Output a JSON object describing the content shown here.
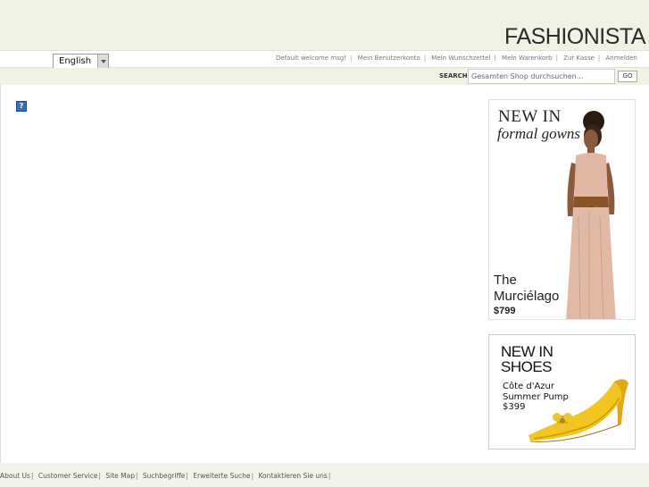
{
  "header": {
    "logo": "FASHIONISTA"
  },
  "topbar": {
    "language": "English",
    "links": [
      "Default welcome msg!",
      "Mein Benutzerkonto",
      "Mein Wunschzettel",
      "Mein Warenkorb",
      "Zur Kasse",
      "Anmelden"
    ]
  },
  "search": {
    "label": "SEARCH",
    "placeholder": "Gesamten Shop durchsuchen...",
    "button": "GO"
  },
  "main": {
    "placeholder_icon": "?"
  },
  "banner_gowns": {
    "title": "NEW IN",
    "subtitle": "formal gowns",
    "name_line1": "The",
    "name_line2": "Murciélago",
    "price": "$799"
  },
  "banner_shoes": {
    "title_line1": "NEW IN",
    "title_line2": "SHOES",
    "product_line1": "Côte d'Azur",
    "product_line2": "Summer Pump",
    "price": "$399"
  },
  "footer": {
    "links": [
      "About Us",
      "Customer Service",
      "Site Map",
      "Suchbegriffe",
      "Erweiterte Suche",
      "Kontaktieren Sie uns"
    ]
  },
  "colors": {
    "header_bg": "#f1f1e4",
    "shoe_yellow": "#f2c521",
    "gown_pink": "#e2b9a5"
  }
}
